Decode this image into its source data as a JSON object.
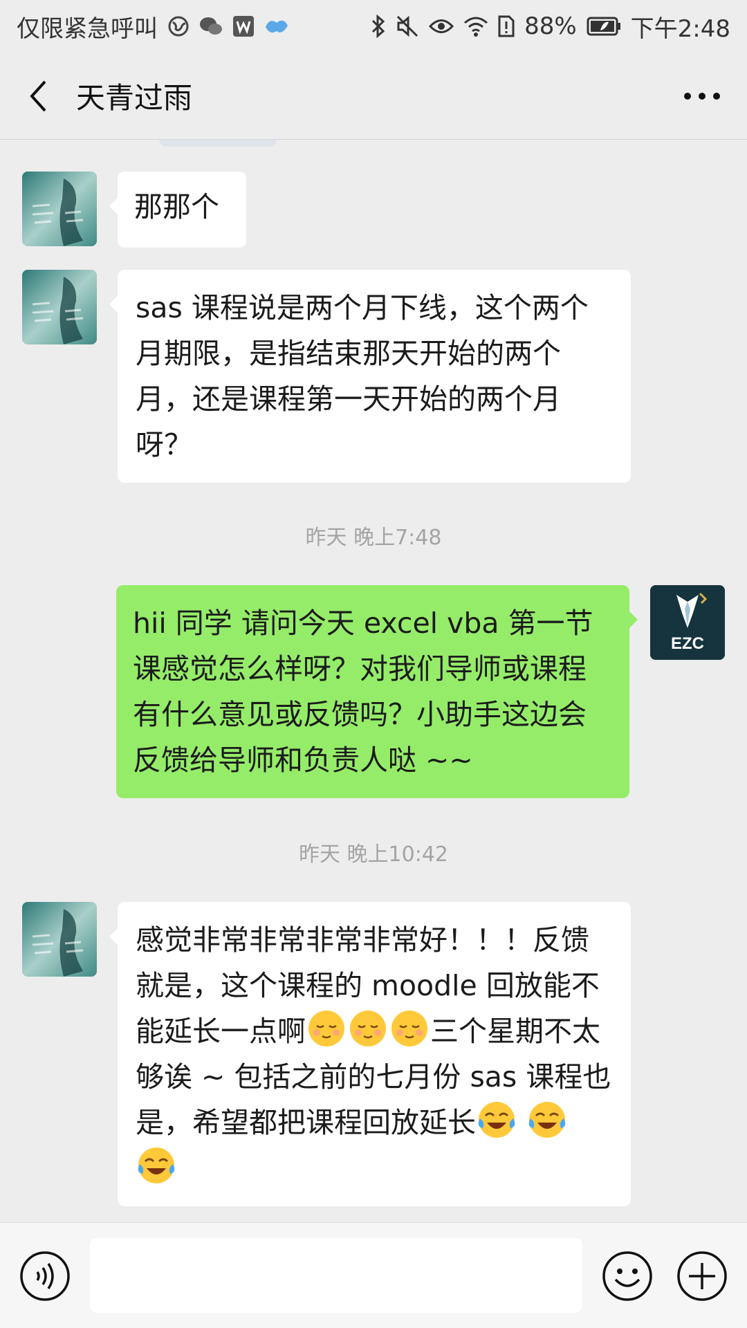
{
  "status_bar": {
    "carrier": "仅限紧急呼叫",
    "battery": "88%",
    "time": "下午2:48"
  },
  "header": {
    "title": "天青过雨"
  },
  "messages": [
    {
      "from": "other",
      "text": "那那个"
    },
    {
      "from": "other",
      "text": "sas 课程说是两个月下线，这个两个月期限，是指结束那天开始的两个月，还是课程第一天开始的两个月呀？"
    },
    {
      "type": "timestamp",
      "text": "昨天 晚上7:48"
    },
    {
      "from": "me",
      "avatar_label": "EZC",
      "text": "hii 同学 请问今天 excel vba 第一节课感觉怎么样呀？对我们导师或课程有什么意见或反馈吗？小助手这边会反馈给导师和负责人哒 ~~"
    },
    {
      "type": "timestamp",
      "text": "昨天 晚上10:42"
    },
    {
      "from": "other",
      "text_part1": "感觉非常非常非常非常好！！！反馈就是，这个课程的 moodle 回放能不能延长一点啊",
      "text_part2": "三个星期不太够诶 ~ 包括之前的七月份 sas 课程也是，希望都把课程回放延长"
    }
  ],
  "colors": {
    "background": "#ededed",
    "my_bubble": "#95ec69",
    "their_bubble": "#ffffff",
    "timestamp": "#a4a4a4"
  }
}
